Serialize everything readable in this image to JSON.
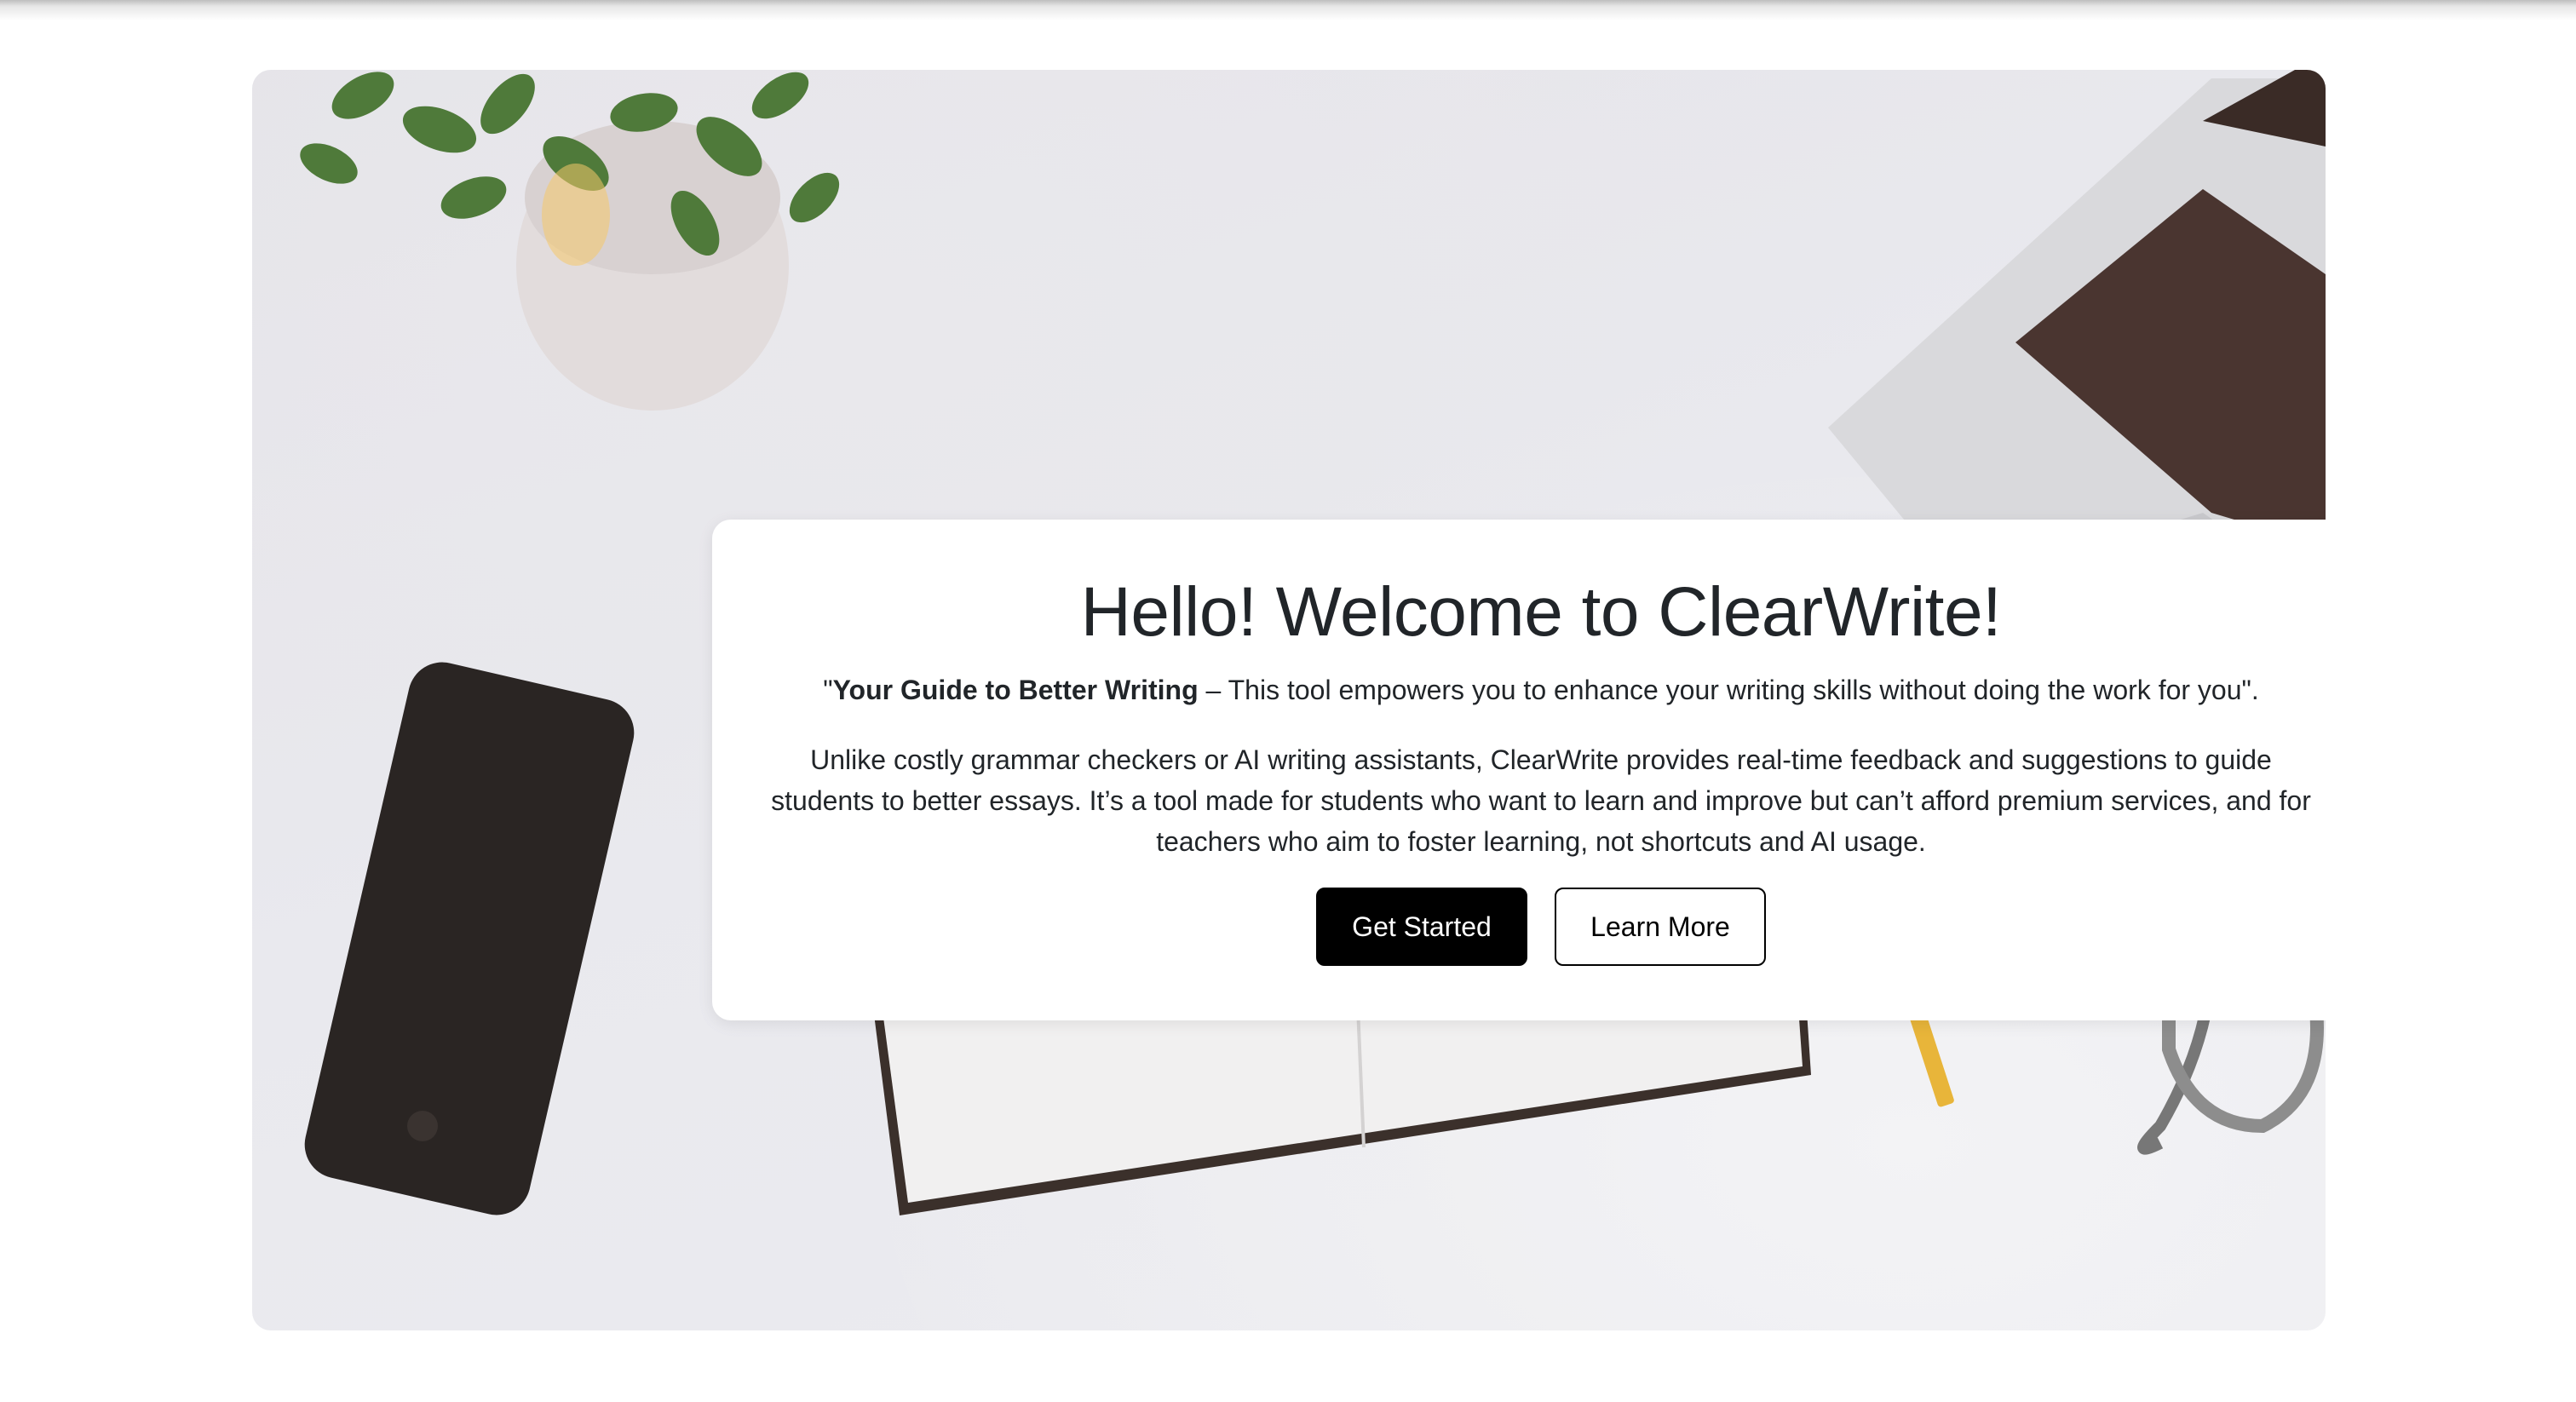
{
  "hero": {
    "background": "desk-workspace-photo",
    "title": "Hello! Welcome to ClearWrite!",
    "tagline": {
      "open_quote": "\"",
      "bold": "Your Guide to Better Writing",
      "rest": " – This tool empowers you to enhance your writing skills without doing the work for you\"."
    },
    "description": "Unlike costly grammar checkers or AI writing assistants, ClearWrite provides real-time feedback and suggestions to guide students to better essays. It’s a tool made for students who want to learn and improve but can’t afford premium services, and for teachers who aim to foster learning, not shortcuts and AI usage.",
    "buttons": {
      "primary_label": "Get Started",
      "secondary_label": "Learn More"
    }
  },
  "colors": {
    "text": "#212529",
    "primary_button": "#000000",
    "page_background": "#ffffff"
  }
}
